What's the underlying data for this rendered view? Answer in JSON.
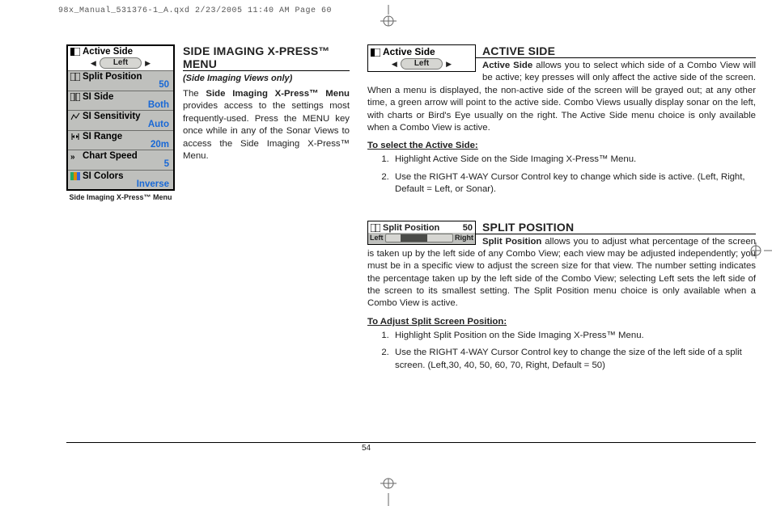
{
  "slug": "98x_Manual_531376-1_A.qxd  2/23/2005  11:40 AM  Page 60",
  "page_number": "54",
  "left": {
    "heading": "SIDE IMAGING X-PRESS™ MENU",
    "subnote": "(Side Imaging Views only)",
    "para": "The <b>Side Imaging X-Press™ Menu</b> provides access to the settings most frequently-used. Press the MENU key once while in any of the Sonar Views to access the Side Imaging X-Press™ Menu.",
    "menu_caption": "Side Imaging X-Press™ Menu",
    "menu": [
      {
        "label": "Active Side",
        "value": "Left",
        "active": true,
        "arrows": true
      },
      {
        "label": "Split Position",
        "value": "50"
      },
      {
        "label": "SI Side",
        "value": "Both"
      },
      {
        "label": "SI Sensitivity",
        "value": "Auto"
      },
      {
        "label": "SI Range",
        "value": "20m"
      },
      {
        "label": "Chart Speed",
        "value": "5"
      },
      {
        "label": "SI Colors",
        "value": "Inverse"
      }
    ]
  },
  "active_side": {
    "heading": "ACTIVE SIDE",
    "mini_label": "Active Side",
    "mini_value": "Left",
    "para": "<b>Active Side</b> allows you to select which side of a Combo View will be active; key presses will only affect the active side of the screen. When a menu is displayed, the non-active side of the screen will be grayed out; at any other time, a green arrow will point to the active side. Combo Views usually display sonar on the left, with charts or Bird's Eye usually on the right. The Active Side menu choice is only available when a Combo View is active.",
    "steps_head": "To select the Active Side:",
    "steps": [
      "Highlight Active Side on the Side Imaging X-Press™ Menu.",
      "Use the RIGHT 4-WAY Cursor Control key to change which side is active. (Left, Right, Default = Left, or Sonar)."
    ]
  },
  "split_position": {
    "heading": "SPLIT POSITION",
    "mini_label": "Split Position",
    "mini_value": "50",
    "bar_left": "Left",
    "bar_right": "Right",
    "para": "<b>Split Position</b> allows you to adjust what percentage of the screen is taken up by the left side of any Combo View; each view may be adjusted independently; you must be in a specific view to adjust the screen size for that view. The number setting indicates the percentage taken up by the left side of the Combo View; selecting Left sets the left side of the screen to its smallest setting. The Split Position menu choice is only available when a Combo View is active.",
    "steps_head": "To Adjust Split Screen Position:",
    "steps": [
      "Highlight Split Position on the Side Imaging X-Press™ Menu.",
      "Use the RIGHT 4-WAY Cursor Control key to change the size of the left side of a split screen. (Left,30, 40, 50, 60, 70, Right, Default = 50)"
    ]
  }
}
